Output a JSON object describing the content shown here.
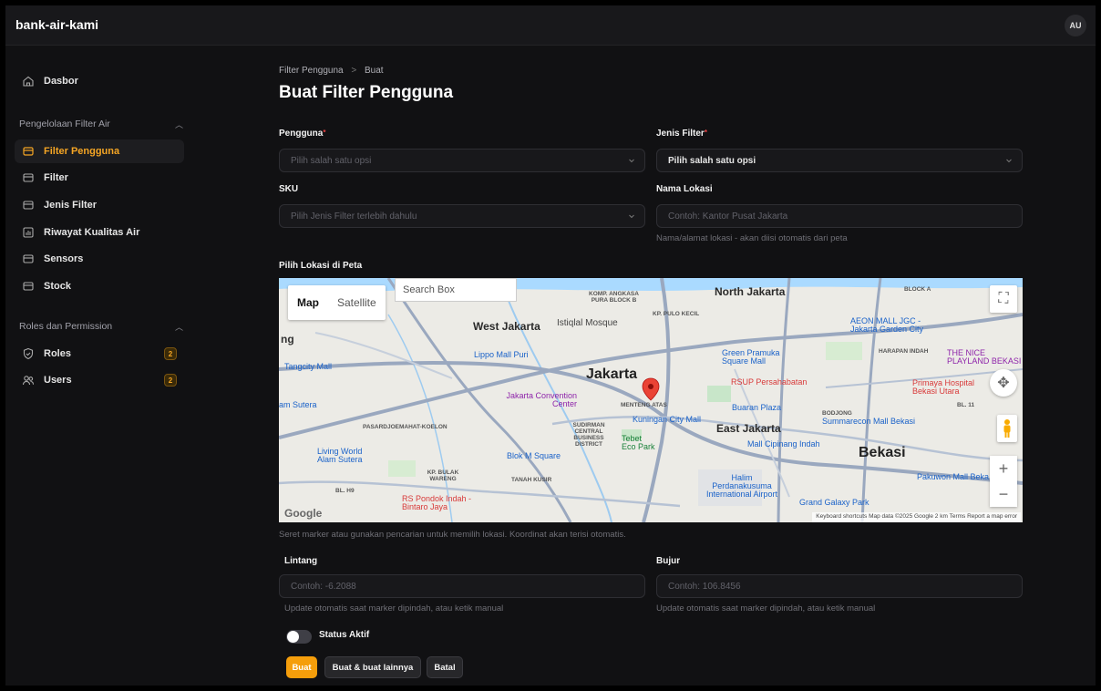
{
  "app": {
    "brand": "bank-air-kami",
    "avatar": "AU"
  },
  "sidebar": {
    "dashboard": "Dasbor",
    "group1": "Pengelolaan Filter Air",
    "group1_items": [
      "Filter Pengguna",
      "Filter",
      "Jenis Filter",
      "Riwayat Kualitas Air",
      "Sensors",
      "Stock"
    ],
    "group2": "Roles dan Permission",
    "roles": {
      "label": "Roles",
      "badge": "2"
    },
    "users": {
      "label": "Users",
      "badge": "2"
    }
  },
  "breadcrumb": {
    "parent": "Filter Pengguna",
    "separator": ">",
    "current": "Buat"
  },
  "page_title": "Buat Filter Pengguna",
  "form": {
    "pengguna": {
      "label": "Pengguna",
      "placeholder": "Pilih salah satu opsi"
    },
    "jenis_filter": {
      "label": "Jenis Filter",
      "value": "Pilih salah satu opsi"
    },
    "sku": {
      "label": "SKU",
      "placeholder": "Pilih Jenis Filter terlebih dahulu"
    },
    "nama_lokasi": {
      "label": "Nama Lokasi",
      "placeholder": "Contoh: Kantor Pusat Jakarta",
      "hint": "Nama/alamat lokasi - akan diisi otomatis dari peta"
    },
    "map_label": "Pilih Lokasi di Peta",
    "map_hint": "Seret marker atau gunakan pencarian untuk memilih lokasi. Koordinat akan terisi otomatis.",
    "lintang": {
      "label": "Lintang",
      "placeholder": "Contoh: -6.2088",
      "hint": "Update otomatis saat marker dipindah, atau ketik manual"
    },
    "bujur": {
      "label": "Bujur",
      "placeholder": "Contoh: 106.8456",
      "hint": "Update otomatis saat marker dipindah, atau ketik manual"
    },
    "status_aktif": "Status Aktif",
    "buttons": {
      "create": "Buat",
      "create_another": "Buat & buat lainnya",
      "cancel": "Batal"
    }
  },
  "map": {
    "tab_map": "Map",
    "tab_satellite": "Satellite",
    "search_placeholder": "Search Box",
    "labels": {
      "north_jakarta": "North Jakarta",
      "west_jakarta": "West Jakarta",
      "jakarta": "Jakarta",
      "east_jakarta": "East Jakarta",
      "bekasi": "Bekasi",
      "istiqlal": "Istiqlal Mosque",
      "lippo": "Lippo Mall Puri",
      "tangcity": "Tangcity Mall",
      "green_pramuka": "Green Pramuka Square Mall",
      "rsup": "RSUP Persahabatan",
      "aeon": "AEON MALL JGC - Jakarta Garden City",
      "nice": "THE NICE PLAYLAND BEKASI",
      "primaya": "Primaya Hospital Bekasi Utara",
      "convention": "Jakarta Convention Center",
      "kuningan": "Kuningan City Mall",
      "tebet": "Tebet Eco Park",
      "buaran": "Buaran Plaza",
      "summarecon": "Summarecon Mall Bekasi",
      "cipinang": "Mall Cipinang Indah",
      "blokm": "Blok M Square",
      "living_world": "Living World Alam Sutera",
      "pondok_indah": "RS Pondok Indah - Bintaro Jaya",
      "halim": "Halim Perdanakusuma International Airport",
      "grand_galaxy": "Grand Galaxy Park",
      "pakuwon": "Pakuwon Mall Beka",
      "alam_sutera": "am Sutera",
      "menteng": "MENTENG ATAS",
      "pasar": "PASARDJOEMAHAT-KOELON",
      "tanah_kusir": "TANAH KUSIR",
      "kp_bulak": "KP. BULAK WARENG",
      "kp_pulo": "KP. PULO KECIL",
      "komp": "KOMP. ANGKASA PURA BLOCK B",
      "harapan": "HARAPAN INDAH",
      "bodjong": "BODJONG",
      "block_a": "BLOCK A",
      "bl11": "BL. 11",
      "blh9": "BL. H9",
      "sudirman": "SUDIRMAN CENTRAL BUSINESS DISTRICT",
      "ng": "ng",
      "google": "Google",
      "attribution": "Keyboard shortcuts   Map data ©2025 Google   2 km          Terms   Report a map error"
    }
  }
}
